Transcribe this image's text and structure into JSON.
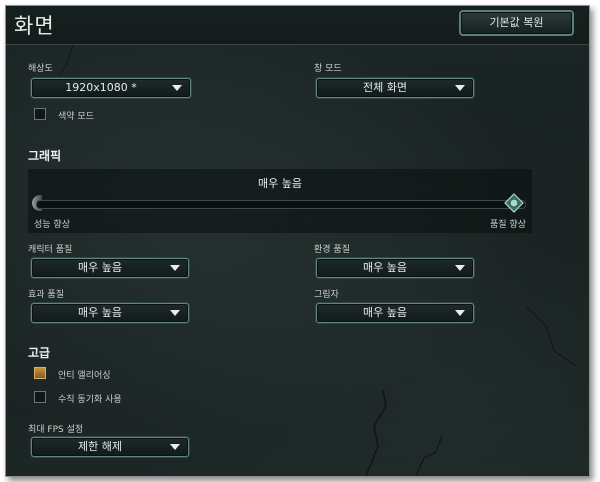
{
  "title": "화면",
  "reset_button": "기본값 복원",
  "resolution": {
    "label": "해상도",
    "value": "1920x1080 *"
  },
  "window_mode": {
    "label": "창 모드",
    "value": "전체 화면"
  },
  "colorblind": {
    "label": "색약 모드",
    "checked": false
  },
  "graphics": {
    "section": "그래픽",
    "slider_value": "매우 높음",
    "slider_min_label": "성능 향상",
    "slider_max_label": "품질 향상",
    "slider_level": 1.0
  },
  "character_quality": {
    "label": "캐릭터 품질",
    "value": "매우 높음"
  },
  "environment_quality": {
    "label": "환경 품질",
    "value": "매우 높음"
  },
  "effects_quality": {
    "label": "효과 품질",
    "value": "매우 높음"
  },
  "shadows": {
    "label": "그림자",
    "value": "매우 높음"
  },
  "advanced": {
    "section": "고급",
    "antialiasing": {
      "label": "안티 앨리어싱",
      "checked": true
    },
    "vsync": {
      "label": "수직 동기화 사용",
      "checked": false
    }
  },
  "fps_cap": {
    "label": "최대 FPS 설정",
    "value": "제한 해제"
  },
  "colors": {
    "accent_border": "#5f8682",
    "checkbox_on": "#c9913c",
    "panel_bg": "#1a2423"
  }
}
